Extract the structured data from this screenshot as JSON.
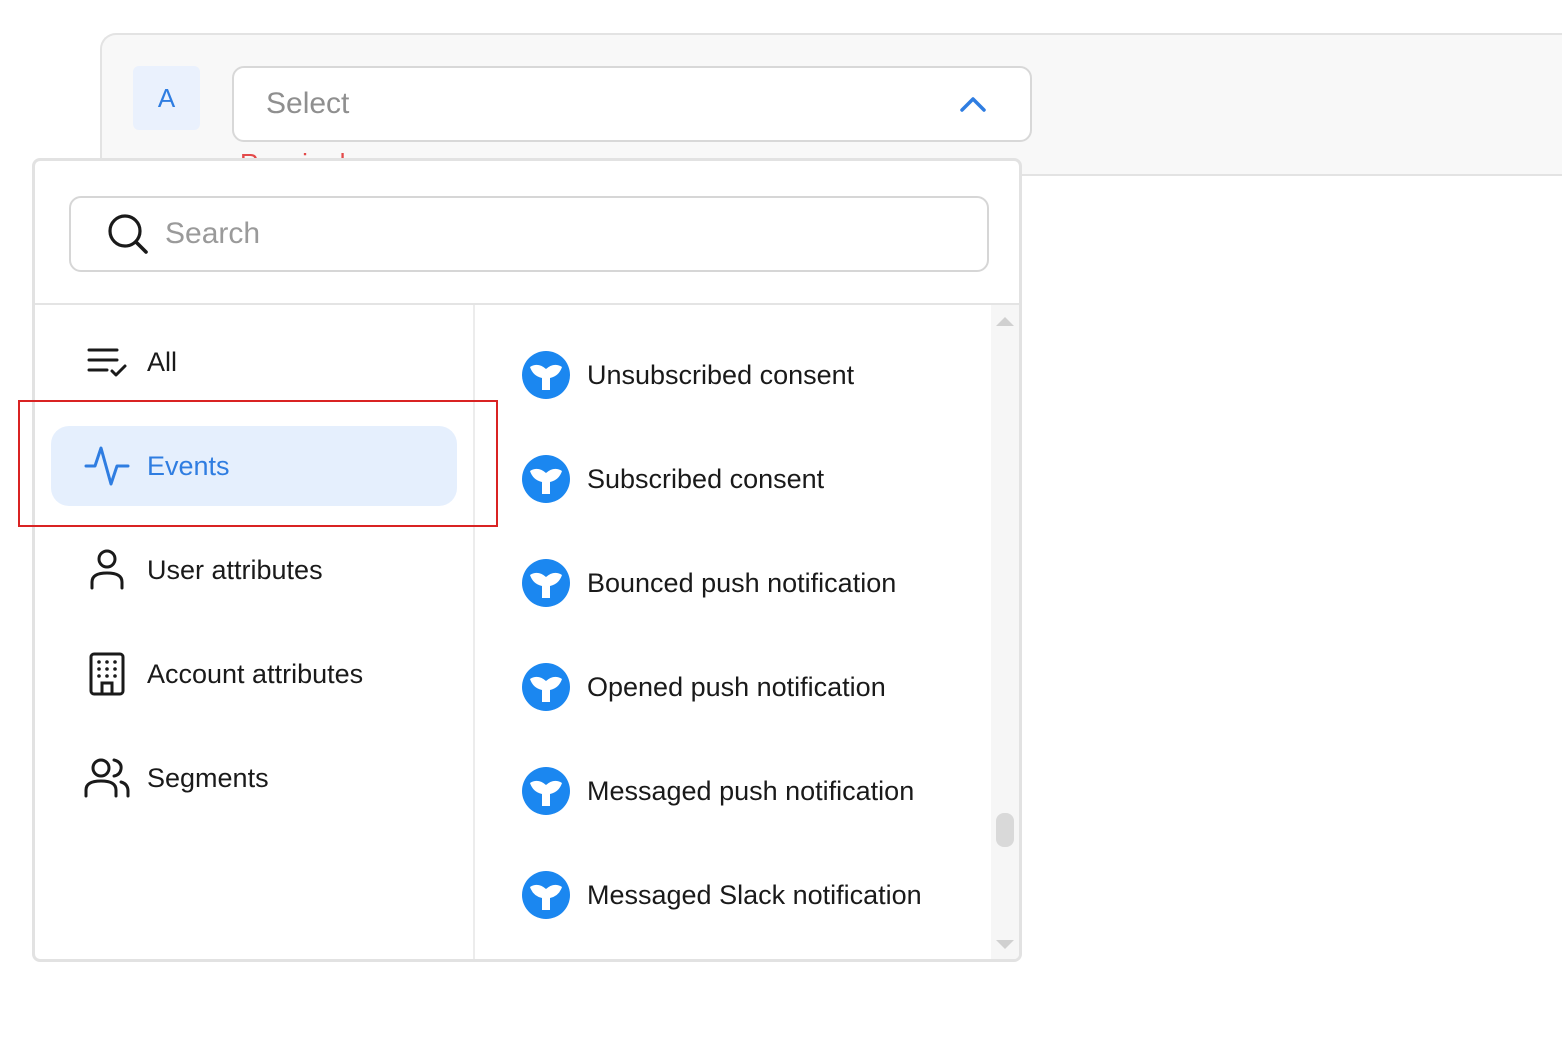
{
  "condition": {
    "letter": "A",
    "select_placeholder": "Select",
    "required_hint": "Required"
  },
  "search": {
    "placeholder": "Search"
  },
  "categories": [
    {
      "label": "All",
      "icon": "list-check-icon",
      "active": false
    },
    {
      "label": "Events",
      "icon": "activity-icon",
      "active": true
    },
    {
      "label": "User attributes",
      "icon": "user-icon",
      "active": false
    },
    {
      "label": "Account attributes",
      "icon": "building-icon",
      "active": false
    },
    {
      "label": "Segments",
      "icon": "users-icon",
      "active": false
    }
  ],
  "events": [
    {
      "label": "Unsubscribed consent",
      "icon": "whale-tail-icon"
    },
    {
      "label": "Subscribed consent",
      "icon": "whale-tail-icon"
    },
    {
      "label": "Bounced push notification",
      "icon": "whale-tail-icon"
    },
    {
      "label": "Opened push notification",
      "icon": "whale-tail-icon"
    },
    {
      "label": "Messaged push notification",
      "icon": "whale-tail-icon"
    },
    {
      "label": "Messaged Slack notification",
      "icon": "whale-tail-icon"
    }
  ],
  "colors": {
    "accent": "#2f7de1",
    "active_bg": "#e5effd",
    "brand_icon": "#1b87f0",
    "highlight": "#d92323",
    "error": "#e34a4a"
  }
}
